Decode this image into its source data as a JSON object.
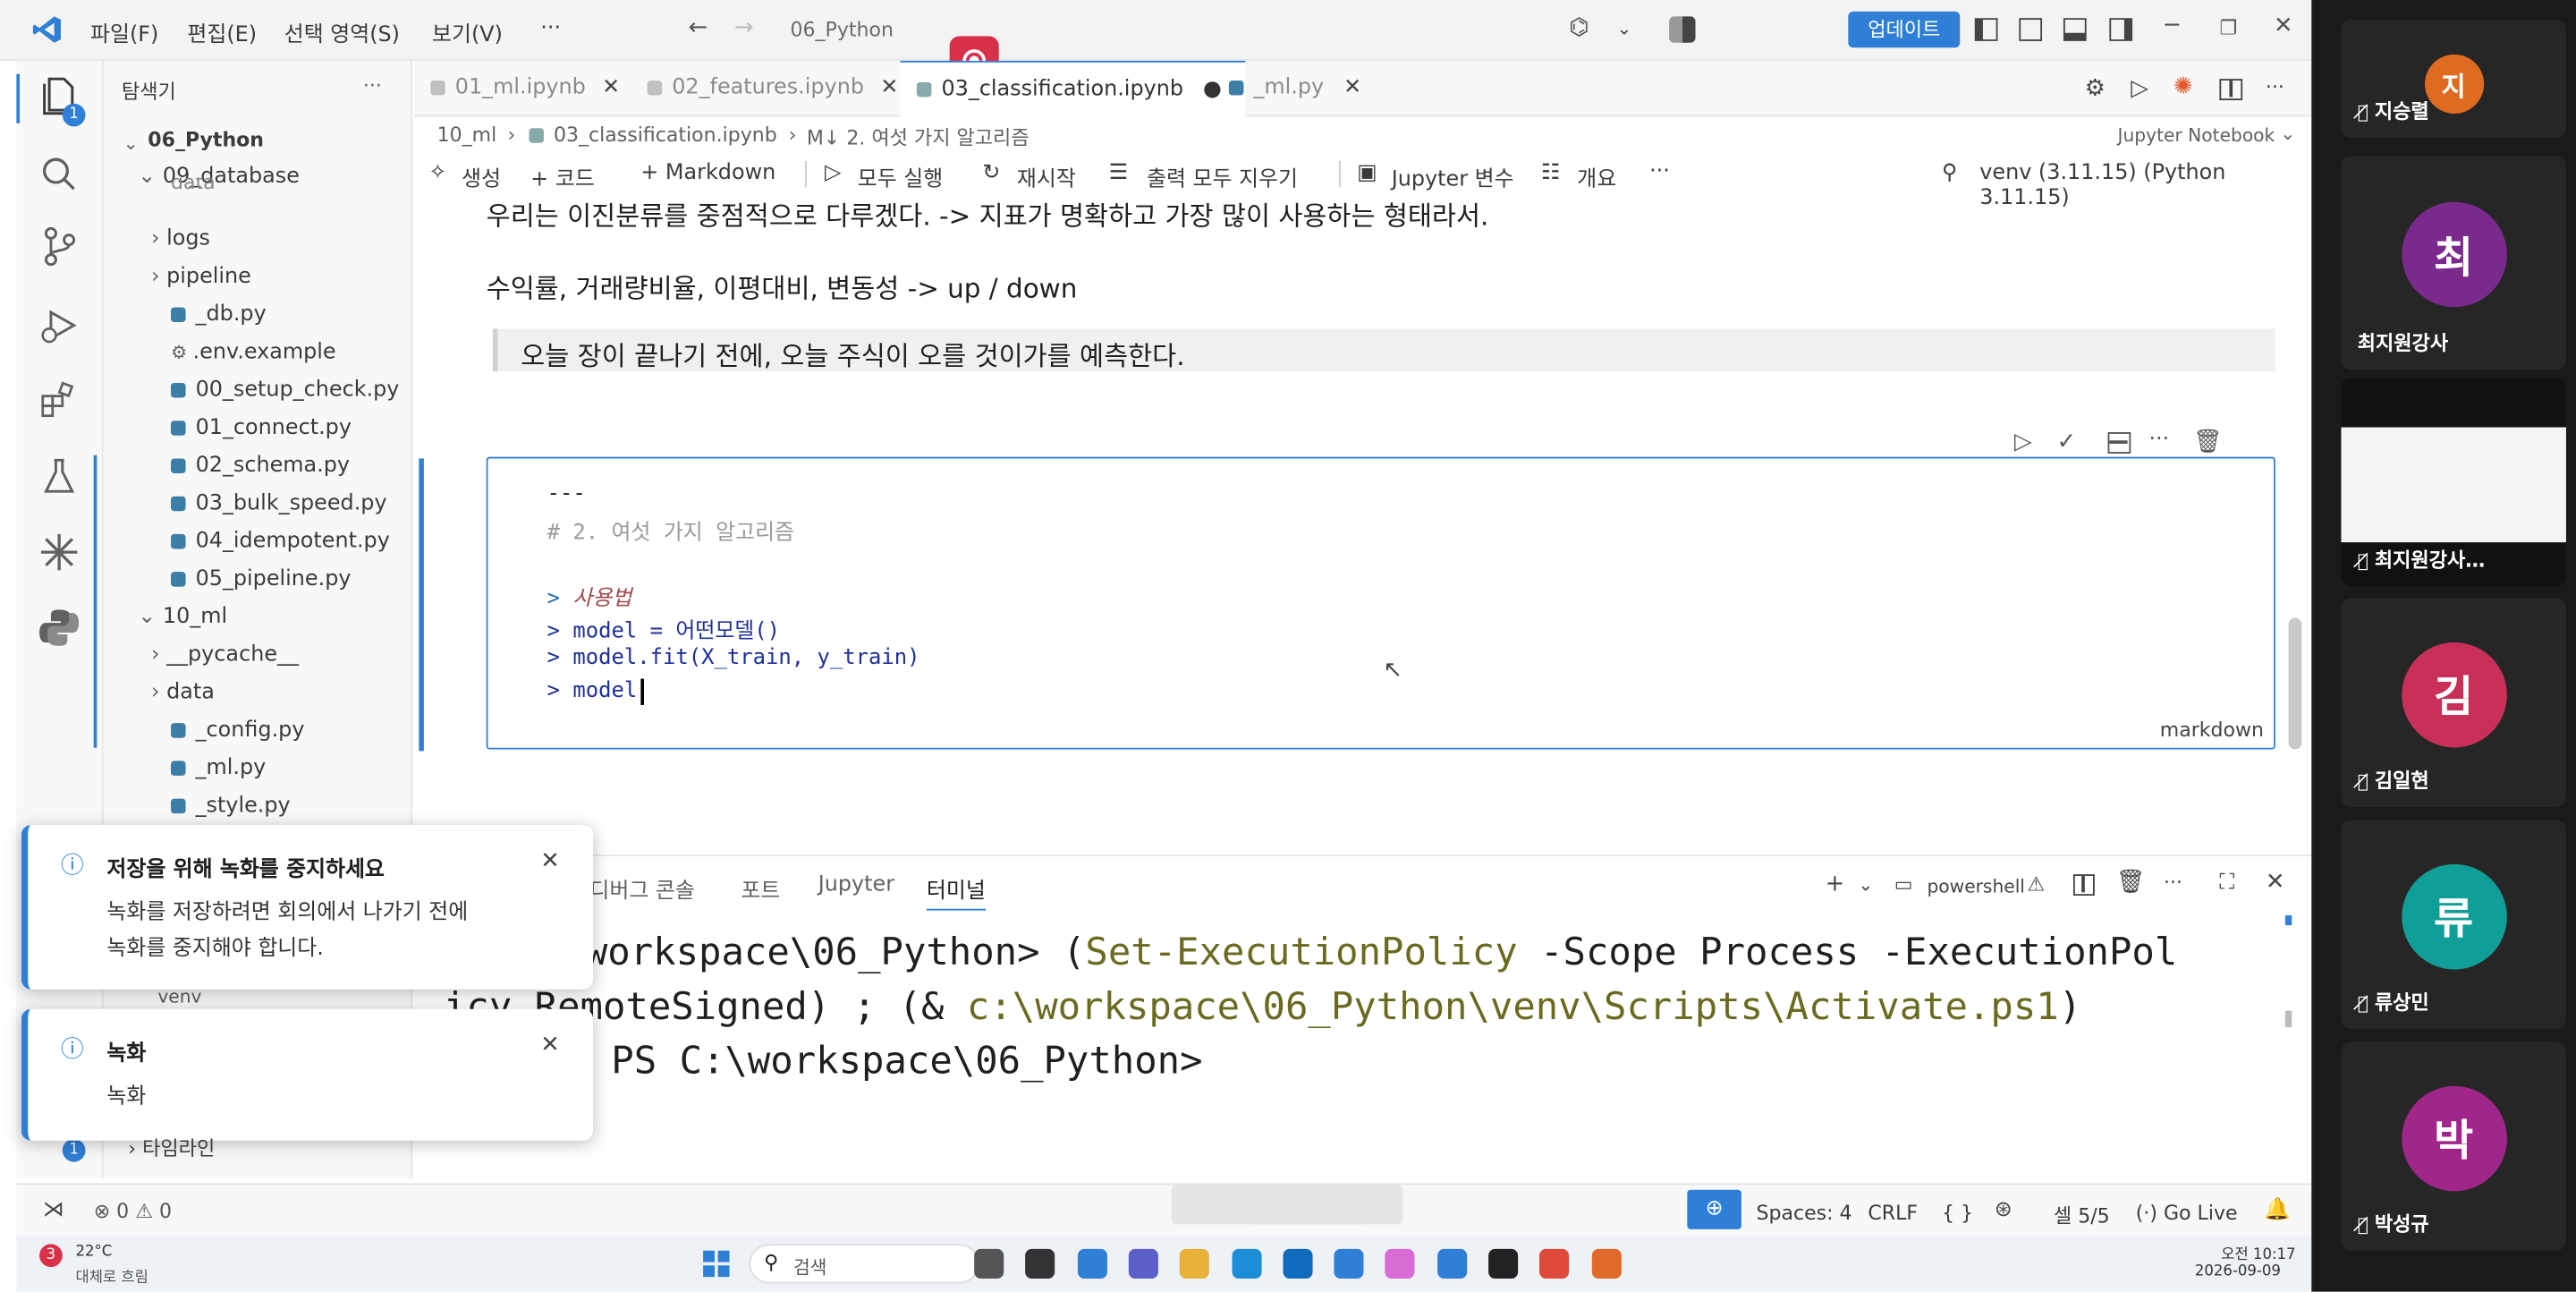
{
  "titlebar": {
    "menu_file": "파일(F)",
    "menu_edit": "편집(E)",
    "menu_selection": "선택 영역(S)",
    "menu_view": "보기(V)",
    "menu_more": "···",
    "search": "06_Python",
    "update_btn": "업데이트"
  },
  "sidebar": {
    "header": "탐색기",
    "more": "···",
    "root": "06_Python",
    "items": [
      {
        "label": "09_database",
        "kind": "folder-open"
      },
      {
        "label": "data",
        "kind": "folder"
      },
      {
        "label": "logs",
        "kind": "folder"
      },
      {
        "label": "pipeline",
        "kind": "folder"
      },
      {
        "label": "_db.py",
        "kind": "py"
      },
      {
        "label": ".env.example",
        "kind": "gear"
      },
      {
        "label": "00_setup_check.py",
        "kind": "py"
      },
      {
        "label": "01_connect.py",
        "kind": "py"
      },
      {
        "label": "02_schema.py",
        "kind": "py"
      },
      {
        "label": "03_bulk_speed.py",
        "kind": "py"
      },
      {
        "label": "04_idempotent.py",
        "kind": "py"
      },
      {
        "label": "05_pipeline.py",
        "kind": "py"
      },
      {
        "label": "10_ml",
        "kind": "folder-open"
      },
      {
        "label": "__pycache__",
        "kind": "folder"
      },
      {
        "label": "data",
        "kind": "folder"
      },
      {
        "label": "_config.py",
        "kind": "py"
      },
      {
        "label": "_ml.py",
        "kind": "py"
      },
      {
        "label": "_style.py",
        "kind": "py"
      }
    ],
    "venv": "venv",
    "timeline": "타임라인",
    "badge": "1"
  },
  "tabs": [
    {
      "label": "01_ml.ipynb"
    },
    {
      "label": "02_features.ipynb"
    },
    {
      "label": "03_classification.ipynb",
      "active": true
    },
    {
      "label": "_ml.py"
    }
  ],
  "breadcrumb": {
    "p1": "10_ml",
    "p2": "03_classification.ipynb",
    "p3": "M↓ 2. 여섯 가지 알고리즘",
    "right": "Jupyter Notebook"
  },
  "nbtoolbar": {
    "generate": "생성",
    "code": "+ 코드",
    "markdown": "+ Markdown",
    "run_all": "모두 실행",
    "restart": "재시작",
    "clear": "출력 모두 지우기",
    "vars": "Jupyter 변수",
    "outline": "개요",
    "more": "···",
    "kernel": "venv (3.11.15) (Python 3.11.15)"
  },
  "notebook": {
    "line1": "우리는 이진분류를 중점적으로 다루겠다. -> 지표가 명확하고 가장 많이 사용하는 형태라서.",
    "line2": "수익률, 거래량비율, 이평대비, 변동성 -> up / down",
    "line3": "오늘 장이 끝나기 전에, 오늘 주식이 오를 것이가를 예측한다.",
    "code": {
      "l1": "---",
      "l2": "# 2. 여섯 가지 알고리즘",
      "l3a": "> ",
      "l3b": "사용법",
      "l4": "> model = 어떤모델()",
      "l5": "> model.fit(X_train, y_train)",
      "l6": "> model",
      "lang": "markdown"
    }
  },
  "panel": {
    "tabs": [
      "디버그 콘솔",
      "포트",
      "Jupyter",
      "터미널"
    ],
    "shell": "powershell",
    "term1a": "workspace\\06_Python> (",
    "term1b": "Set-ExecutionPolicy",
    "term1c": " -Scope Process -ExecutionPol",
    "term2a": "icy RemoteSigned) ; (& ",
    "term2b": "c:\\workspace\\06_Python\\venv\\Scripts\\Activate.ps1",
    "term2c": ")",
    "term3": "PS C:\\workspace\\06_Python>"
  },
  "status": {
    "errors": "0",
    "warnings": "0",
    "spaces": "Spaces: 4",
    "eol": "CRLF",
    "braces": "{ }",
    "cell": "셀 5/5",
    "golive": "Go Live"
  },
  "taskbar": {
    "weather_temp": "22°C",
    "weather_text": "대체로 흐림",
    "search": "검색",
    "time": "오전 10:17",
    "date": "2026-09-09"
  },
  "toasts": [
    {
      "title": "저장을 위해 녹화를 중지하세요",
      "body1": "녹화를 저장하려면 회의에서 나가기 전에",
      "body2": "녹화를 중지해야 합니다."
    },
    {
      "title": "녹화",
      "body1": "녹화"
    }
  ],
  "participants": [
    {
      "initial": "지",
      "name": "지승렬",
      "color": "#e06a1f"
    },
    {
      "initial": "최",
      "name": "최지원강사",
      "color": "#7a2a8c"
    },
    {
      "initial": "",
      "name": "최지원강사…",
      "color": "#ffffff"
    },
    {
      "initial": "김",
      "name": "김일현",
      "color": "#c8305a"
    },
    {
      "initial": "류",
      "name": "류상민",
      "color": "#129e98"
    },
    {
      "initial": "박",
      "name": "박성규",
      "color": "#a0268a"
    }
  ]
}
